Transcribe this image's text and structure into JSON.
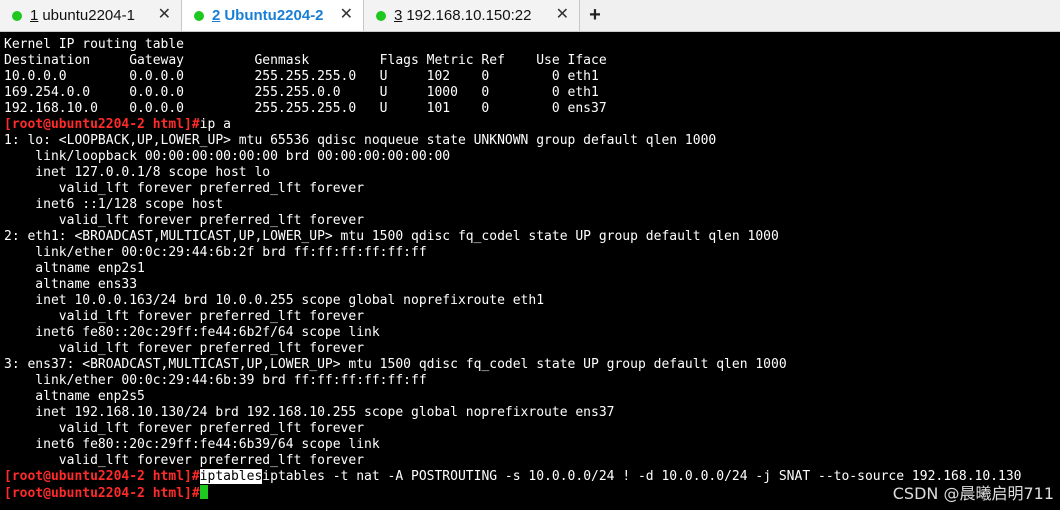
{
  "tabs": [
    {
      "number": "1",
      "title": "ubuntu2204-1",
      "active": false
    },
    {
      "number": "2",
      "title": "Ubuntu2204-2",
      "active": true
    },
    {
      "number": "3",
      "title": "192.168.10.150:22",
      "active": false
    }
  ],
  "add_tab_label": "+",
  "close_label": "✕",
  "terminal": {
    "lines": [
      "Kernel IP routing table",
      "Destination     Gateway         Genmask         Flags Metric Ref    Use Iface",
      "10.0.0.0        0.0.0.0         255.255.255.0   U     102    0        0 eth1",
      "169.254.0.0     0.0.0.0         255.255.0.0     U     1000   0        0 eth1",
      "192.168.10.0    0.0.0.0         255.255.255.0   U     101    0        0 ens37"
    ],
    "prompt": "[root@ubuntu2204-2 html]#",
    "command1": "ip a",
    "output": [
      "1: lo: <LOOPBACK,UP,LOWER_UP> mtu 65536 qdisc noqueue state UNKNOWN group default qlen 1000",
      "    link/loopback 00:00:00:00:00:00 brd 00:00:00:00:00:00",
      "    inet 127.0.0.1/8 scope host lo",
      "       valid_lft forever preferred_lft forever",
      "    inet6 ::1/128 scope host",
      "       valid_lft forever preferred_lft forever",
      "2: eth1: <BROADCAST,MULTICAST,UP,LOWER_UP> mtu 1500 qdisc fq_codel state UP group default qlen 1000",
      "    link/ether 00:0c:29:44:6b:2f brd ff:ff:ff:ff:ff:ff",
      "    altname enp2s1",
      "    altname ens33",
      "    inet 10.0.0.163/24 brd 10.0.0.255 scope global noprefixroute eth1",
      "       valid_lft forever preferred_lft forever",
      "    inet6 fe80::20c:29ff:fe44:6b2f/64 scope link",
      "       valid_lft forever preferred_lft forever",
      "3: ens37: <BROADCAST,MULTICAST,UP,LOWER_UP> mtu 1500 qdisc fq_codel state UP group default qlen 1000",
      "    link/ether 00:0c:29:44:6b:39 brd ff:ff:ff:ff:ff:ff",
      "    altname enp2s5",
      "    inet 192.168.10.130/24 brd 192.168.10.255 scope global noprefixroute ens37",
      "       valid_lft forever preferred_lft forever",
      "    inet6 fe80::20c:29ff:fe44:6b39/64 scope link",
      "       valid_lft forever preferred_lft forever"
    ],
    "command2_selected": "iptables",
    "command2_rest": "iptables -t nat -A POSTROUTING -s 10.0.0.0/24 ! -d 10.0.0.0/24 -j SNAT --to-source 192.168.10.130"
  },
  "watermark": "CSDN @晨曦启明711",
  "colors": {
    "prompt": "#ff2a2a",
    "cursor": "#1ec81e",
    "active_tab": "#1a7fd4",
    "status_dot": "#1ec81e"
  }
}
